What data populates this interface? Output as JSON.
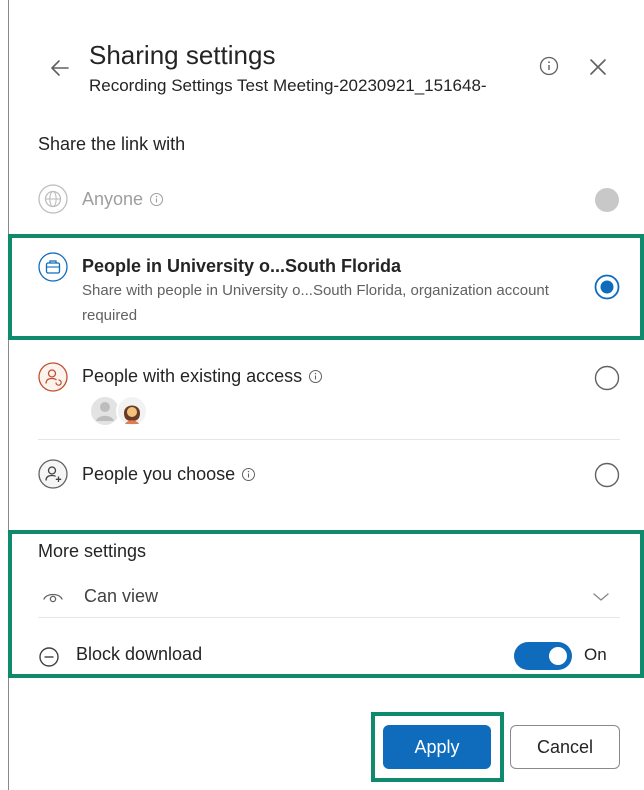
{
  "header": {
    "title": "Sharing settings",
    "subtitle": "Recording Settings Test Meeting-20230921_151648-"
  },
  "share_section": {
    "title": "Share the link with",
    "options": [
      {
        "label": "Anyone",
        "sublabel": "",
        "state": "disabled",
        "icon": "globe-icon"
      },
      {
        "label": "People in University o...South Florida",
        "sublabel": "Share with people in University o...South Florida, organization account required",
        "state": "selected",
        "icon": "building-icon"
      },
      {
        "label": "People with existing access",
        "sublabel": "",
        "state": "unselected",
        "icon": "person-sync-icon"
      },
      {
        "label": "People you choose",
        "sublabel": "",
        "state": "unselected",
        "icon": "person-add-icon"
      }
    ]
  },
  "more_settings": {
    "title": "More settings",
    "permission": "Can view",
    "block_download_label": "Block download",
    "block_download_state": "On",
    "block_download_on": true
  },
  "footer": {
    "apply_label": "Apply",
    "cancel_label": "Cancel"
  },
  "colors": {
    "accent": "#0f6cbd",
    "highlight": "#0f8a6c",
    "person_icon": "#c0502f"
  }
}
